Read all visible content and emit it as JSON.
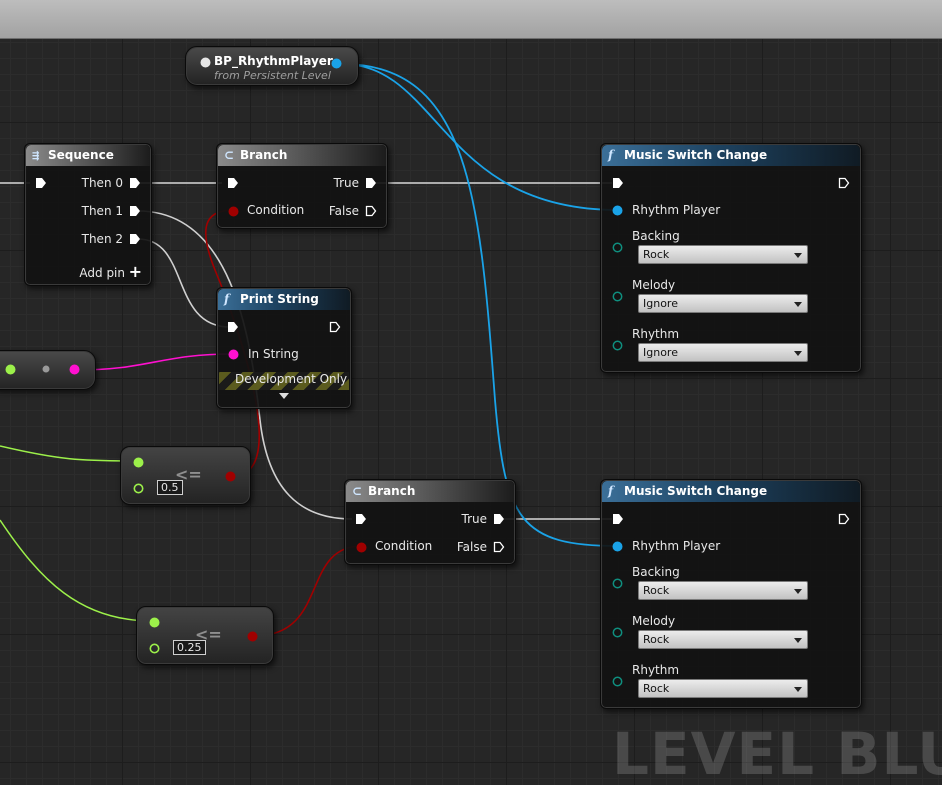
{
  "watermark": "LEVEL BLUEP",
  "player_ref": {
    "title": "BP_RhythmPlayer",
    "subtitle": "from Persistent Level"
  },
  "sequence": {
    "title": "Sequence",
    "outputs": [
      "Then 0",
      "Then 1",
      "Then 2"
    ],
    "add_pin": "Add pin"
  },
  "branch_top": {
    "title": "Branch",
    "condition": "Condition",
    "true_label": "True",
    "false_label": "False"
  },
  "branch_bottom": {
    "title": "Branch",
    "condition": "Condition",
    "true_label": "True",
    "false_label": "False"
  },
  "print_string": {
    "title": "Print String",
    "in_string": "In String",
    "dev_only": "Development Only"
  },
  "compare_top": {
    "value": "0.5",
    "symbol": "<="
  },
  "compare_bottom": {
    "value": "0.25",
    "symbol": "<="
  },
  "music_top": {
    "title": "Music Switch Change",
    "rhythm_player": "Rhythm Player",
    "backing_label": "Backing",
    "backing_value": "Rock",
    "melody_label": "Melody",
    "melody_value": "Ignore",
    "rhythm_label": "Rhythm",
    "rhythm_value": "Ignore"
  },
  "music_bottom": {
    "title": "Music Switch Change",
    "rhythm_player": "Rhythm Player",
    "backing_label": "Backing",
    "backing_value": "Rock",
    "melody_label": "Melody",
    "melody_value": "Rock",
    "rhythm_label": "Rhythm",
    "rhythm_value": "Rock"
  },
  "colors": {
    "exec_wire": "#d8d8d8",
    "object_pin": "#1aa3e8",
    "bool_pin": "#a00000",
    "string_pin": "#ff10d0",
    "float_pin": "#9cf04a",
    "node_header_function": "#1d4260"
  },
  "icons": [
    "sequence-icon",
    "branch-icon",
    "function-icon",
    "plus-icon",
    "dropdown-arrow-icon"
  ]
}
